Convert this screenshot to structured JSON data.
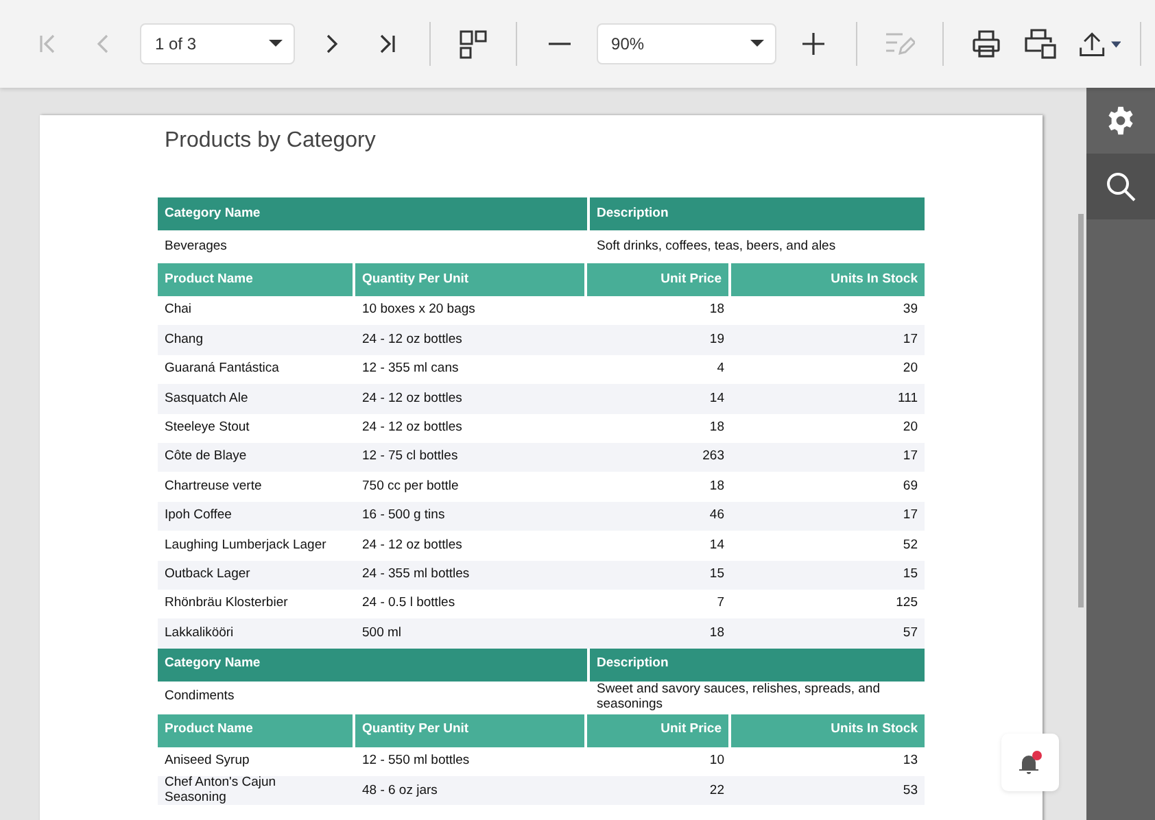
{
  "toolbar": {
    "first_page": {
      "disabled": true
    },
    "previous_page": {
      "disabled": true
    },
    "page_select": {
      "value": "1 of 3"
    },
    "next_page": {
      "disabled": false
    },
    "last_page": {
      "disabled": false
    },
    "zoom_select": {
      "value": "90%"
    },
    "edit": {
      "disabled": true
    }
  },
  "sidebar": {
    "tabs": [
      {
        "selected": false
      },
      {
        "selected": true
      }
    ]
  },
  "report": {
    "title": "Products by Category",
    "groups": [
      {
        "category_columns": [
          "Category Name",
          "Description"
        ],
        "category": {
          "name": "Beverages",
          "description": "Soft drinks, coffees, teas, beers, and ales"
        },
        "product_columns": [
          "Product Name",
          "Quantity Per Unit",
          "Unit Price",
          "Units In Stock"
        ],
        "products": [
          [
            "Chai",
            "10 boxes x 20 bags",
            "18",
            "39"
          ],
          [
            "Chang",
            "24 - 12 oz bottles",
            "19",
            "17"
          ],
          [
            "Guaraná Fantástica",
            "12 - 355 ml cans",
            "4",
            "20"
          ],
          [
            "Sasquatch Ale",
            "24 - 12 oz bottles",
            "14",
            "111"
          ],
          [
            "Steeleye Stout",
            "24 - 12 oz bottles",
            "18",
            "20"
          ],
          [
            "Côte de Blaye",
            "12 - 75 cl bottles",
            "263",
            "17"
          ],
          [
            "Chartreuse verte",
            "750 cc per bottle",
            "18",
            "69"
          ],
          [
            "Ipoh Coffee",
            "16 - 500 g tins",
            "46",
            "17"
          ],
          [
            "Laughing Lumberjack Lager",
            "24 - 12 oz bottles",
            "14",
            "52"
          ],
          [
            "Outback Lager",
            "24 - 355 ml bottles",
            "15",
            "15"
          ],
          [
            "Rhönbräu Klosterbier",
            "24 - 0.5 l bottles",
            "7",
            "125"
          ],
          [
            "Lakkalikööri",
            "500 ml",
            "18",
            "57"
          ]
        ]
      },
      {
        "category_columns": [
          "Category Name",
          "Description"
        ],
        "category": {
          "name": "Condiments",
          "description": "Sweet and savory sauces, relishes, spreads, and seasonings"
        },
        "product_columns": [
          "Product Name",
          "Quantity Per Unit",
          "Unit Price",
          "Units In Stock"
        ],
        "products": [
          [
            "Aniseed Syrup",
            "12 - 550 ml bottles",
            "10",
            "13"
          ],
          [
            "Chef Anton's Cajun Seasoning",
            "48 - 6 oz jars",
            "22",
            "53"
          ]
        ]
      }
    ]
  }
}
